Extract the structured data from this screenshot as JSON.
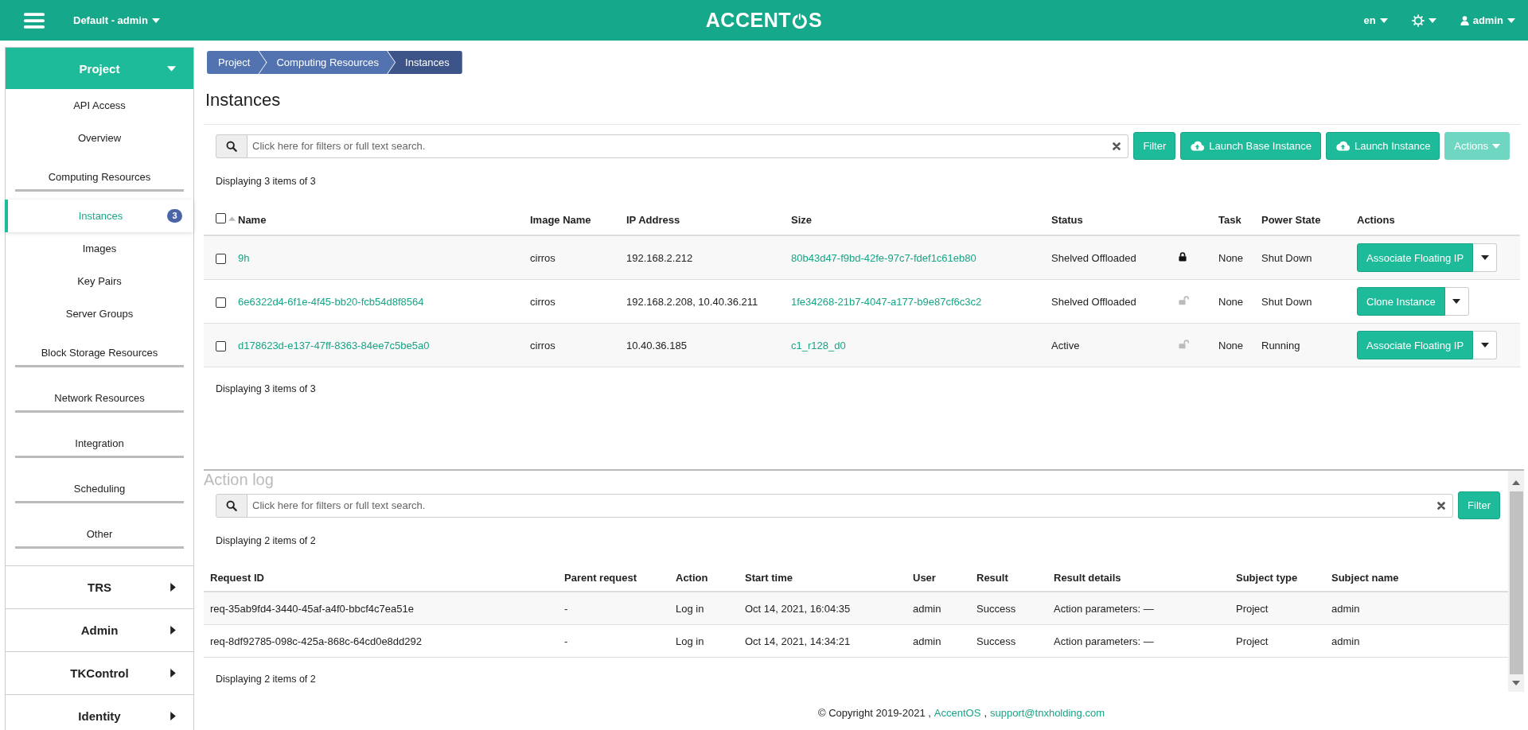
{
  "topbar": {
    "project_selector": "Default - admin",
    "logo_start": "ACCENT",
    "logo_end": "S",
    "language": "en",
    "user": "admin"
  },
  "sidebar": {
    "panels": [
      {
        "label": "Project",
        "expanded": true,
        "items": [
          {
            "kind": "link",
            "label": "API Access",
            "selected": false
          },
          {
            "kind": "link",
            "label": "Overview",
            "selected": false
          },
          {
            "kind": "group",
            "label": "Computing Resources",
            "children": [
              {
                "kind": "link",
                "label": "Instances",
                "selected": true,
                "badge": "3"
              },
              {
                "kind": "link",
                "label": "Images",
                "selected": false
              },
              {
                "kind": "link",
                "label": "Key Pairs",
                "selected": false
              },
              {
                "kind": "link",
                "label": "Server Groups",
                "selected": false
              }
            ]
          },
          {
            "kind": "group",
            "label": "Block Storage Resources"
          },
          {
            "kind": "group",
            "label": "Network Resources"
          },
          {
            "kind": "group",
            "label": "Integration"
          },
          {
            "kind": "group",
            "label": "Scheduling"
          },
          {
            "kind": "group",
            "label": "Other"
          }
        ]
      },
      {
        "label": "TRS",
        "expanded": false
      },
      {
        "label": "Admin",
        "expanded": false
      },
      {
        "label": "TKControl",
        "expanded": false
      },
      {
        "label": "Identity",
        "expanded": false
      }
    ]
  },
  "breadcrumb": [
    "Project",
    "Computing Resources",
    "Instances"
  ],
  "title": "Instances",
  "instances": {
    "search": {
      "placeholder": "Click here for filters or full text search."
    },
    "buttons": [
      {
        "kind": "filter",
        "label": "Filter",
        "disabled": false
      },
      {
        "kind": "launch",
        "label": "Launch Base Instance",
        "disabled": false
      },
      {
        "kind": "launch",
        "label": "Launch Instance",
        "disabled": false
      },
      {
        "kind": "menu",
        "label": "Actions",
        "disabled": true
      }
    ],
    "count_top": "Displaying 3 items of 3",
    "select_all_checked": false,
    "columns": [
      "Name",
      "Image Name",
      "IP Address",
      "Size",
      "Status",
      "Task",
      "Power State",
      "Actions"
    ],
    "rows": [
      {
        "checked": false,
        "name": "9h",
        "image_name": "cirros",
        "ip_address": "192.168.2.212",
        "size": "80b43d47-f9bd-42fe-97c7-fdef1c61eb80",
        "status": "Shelved Offloaded",
        "locked": true,
        "task": "None",
        "power_state": "Shut Down",
        "action": "Associate Floating IP"
      },
      {
        "checked": false,
        "name": "6e6322d4-6f1e-4f45-bb20-fcb54d8f8564",
        "image_name": "cirros",
        "ip_address": "192.168.2.208, 10.40.36.211",
        "size": "1fe34268-21b7-4047-a177-b9e87cf6c3c2",
        "status": "Shelved Offloaded",
        "locked": false,
        "task": "None",
        "power_state": "Shut Down",
        "action": "Clone Instance"
      },
      {
        "checked": false,
        "name": "d178623d-e137-47ff-8363-84ee7c5be5a0",
        "image_name": "cirros",
        "ip_address": "10.40.36.185",
        "size": "c1_r128_d0",
        "status": "Active",
        "locked": false,
        "task": "None",
        "power_state": "Running",
        "action": "Associate Floating IP"
      }
    ],
    "count_bottom": "Displaying 3 items of 3"
  },
  "action_log": {
    "title": "Action log",
    "search": {
      "placeholder": "Click here for filters or full text search."
    },
    "filter_button": "Filter",
    "count_top": "Displaying 2 items of 2",
    "columns": [
      "Request ID",
      "Parent request",
      "Action",
      "Start time",
      "User",
      "Result",
      "Result details",
      "Subject type",
      "Subject name"
    ],
    "rows": [
      [
        "req-35ab9fd4-3440-45af-a4f0-bbcf4c7ea51e",
        "-",
        "Log in",
        "Oct 14, 2021, 16:04:35",
        "admin",
        "Success",
        "Action parameters: —",
        "Project",
        "admin"
      ],
      [
        "req-8df92785-098c-425a-868c-64cd0e8dd292",
        "-",
        "Log in",
        "Oct 14, 2021, 14:34:21",
        "admin",
        "Success",
        "Action parameters: —",
        "Project",
        "admin"
      ]
    ],
    "count_bottom": "Displaying 2 items of 2"
  },
  "footer": {
    "copyright": "© Copyright 2019-2021 ,",
    "product_link": "AccentOS",
    "separator": ",",
    "email_link": "support@tnxholding.com"
  }
}
